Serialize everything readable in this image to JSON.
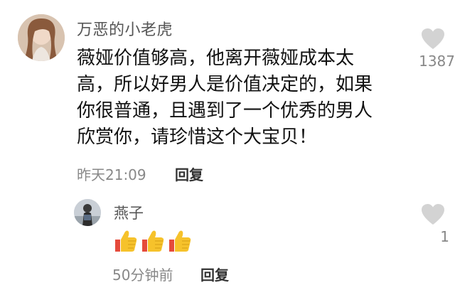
{
  "main_comment": {
    "username": "万恶的小老虎",
    "text_lines": [
      "薇娅价值够高，他离开薇娅成本太",
      "高，所以好男人是价值决定的，如果",
      "你很普通，且遇到了一个优秀的男人",
      "欣赏你，请珍惜这个大宝贝！"
    ],
    "timestamp": "昨天21:09",
    "reply_label": "回复",
    "like_count": "1387",
    "like_icon": "heart-icon"
  },
  "reply_comment": {
    "username": "燕子",
    "emojis": [
      "thumbs-up-icon",
      "thumbs-up-icon",
      "thumbs-up-icon"
    ],
    "timestamp": "50分钟前",
    "reply_label": "回复",
    "like_count": "1",
    "like_icon": "heart-icon"
  },
  "colors": {
    "meta_text": "#888888",
    "heart": "#d3d3d3",
    "thumb": "#f6c22b",
    "thumb_shadow": "#e54a3b"
  }
}
